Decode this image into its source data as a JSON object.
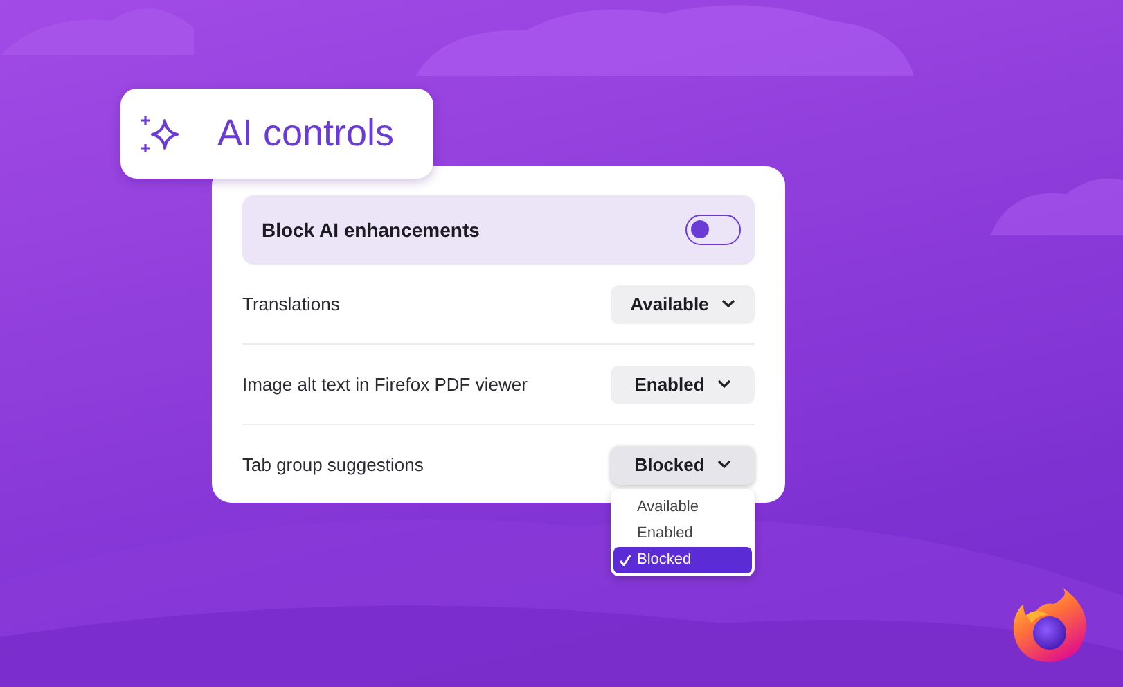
{
  "header": {
    "title": "AI controls"
  },
  "block_toggle": {
    "label": "Block AI enhancements",
    "on": false
  },
  "settings": [
    {
      "label": "Translations",
      "value": "Available",
      "expanded": false
    },
    {
      "label": "Image alt text in Firefox PDF viewer",
      "value": "Enabled",
      "expanded": false
    },
    {
      "label": "Tab group suggestions",
      "value": "Blocked",
      "expanded": true,
      "options": [
        {
          "label": "Available",
          "selected": false
        },
        {
          "label": "Enabled",
          "selected": false
        },
        {
          "label": "Blocked",
          "selected": true
        }
      ]
    }
  ]
}
